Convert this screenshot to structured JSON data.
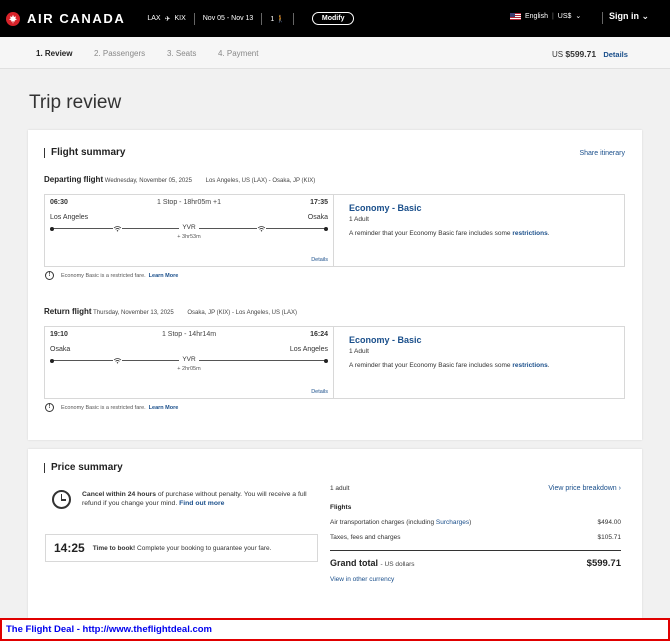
{
  "header": {
    "brand": "AIR CANADA",
    "origin": "LAX",
    "destination": "KIX",
    "dates": "Nov 05 - Nov 13",
    "passengers": "1",
    "modify_label": "Modify",
    "language": "English",
    "currency": "US$",
    "signin_label": "Sign in"
  },
  "steps": [
    "1. Review",
    "2. Passengers",
    "3. Seats",
    "4. Payment"
  ],
  "top_price": {
    "currency": "US",
    "amount": "$599.71",
    "details_label": "Details"
  },
  "page_title": "Trip review",
  "flight_summary": {
    "title": "Flight summary",
    "share_label": "Share itinerary",
    "flights": [
      {
        "heading": "Departing flight",
        "date": "Wednesday, November 05, 2025",
        "route": "Los Angeles, US (LAX) - Osaka, JP (KIX)",
        "dep_time": "06:30",
        "arr_time": "17:35",
        "stops": "1 Stop - 18hr05m +1",
        "dep_city": "Los Angeles",
        "arr_city": "Osaka",
        "via": "YVR",
        "layover": "+ 3hr53m",
        "details_label": "Details",
        "cabin": "Economy - Basic",
        "pax": "1 Adult",
        "reminder": "A reminder that your Economy Basic fare includes some",
        "restrictions_label": "restrictions",
        "restricted_note": "Economy Basic is a restricted fare.",
        "learn_more": "Learn More"
      },
      {
        "heading": "Return flight",
        "date": "Thursday, November 13, 2025",
        "route": "Osaka, JP (KIX) - Los Angeles, US (LAX)",
        "dep_time": "19:10",
        "arr_time": "16:24",
        "stops": "1 Stop - 14hr14m",
        "dep_city": "Osaka",
        "arr_city": "Los Angeles",
        "via": "YVR",
        "layover": "+ 2hr05m",
        "details_label": "Details",
        "cabin": "Economy - Basic",
        "pax": "1 Adult",
        "reminder": "A reminder that your Economy Basic fare includes some",
        "restrictions_label": "restrictions",
        "restricted_note": "Economy Basic is a restricted fare.",
        "learn_more": "Learn More"
      }
    ]
  },
  "price_summary": {
    "title": "Price summary",
    "cancel_bold": "Cancel within 24 hours",
    "cancel_text": "of purchase without penalty. You will receive a full refund if you change your mind.",
    "find_out_more": "Find out more",
    "timer": "14:25",
    "timer_bold": "Time to book!",
    "timer_text": "Complete your booking to guarantee your fare.",
    "adults": "1 adult",
    "breakdown_label": "View price breakdown",
    "flights_label": "Flights",
    "air_transport_label": "Air transportation charges (including",
    "surcharges_label": "Surcharges",
    "air_transport_close": ")",
    "air_transport_value": "$494.00",
    "taxes_label": "Taxes, fees and charges",
    "taxes_value": "$105.71",
    "grand_total_label": "Grand total",
    "grand_total_currency": "- US dollars",
    "grand_total_value": "$599.71",
    "other_currency": "View in other currency"
  },
  "footer": {
    "text": "The Flight Deal - http://www.theflightdeal.com"
  }
}
